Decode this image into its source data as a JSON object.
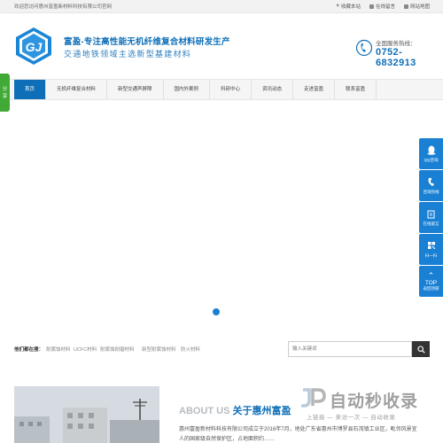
{
  "topbar": {
    "welcome": "欢迎您访问惠州富盈新材料科技有限公司官网",
    "links": [
      "收藏本站",
      "在线留言",
      "网站地图"
    ]
  },
  "header": {
    "brand_title": "富盈-专注高性能无机纤维复合材料研发生产",
    "brand_sub": "交通地铁领域主选新型基建材料",
    "hotline_label": "全国服务热线：",
    "hotline_number": "0752-6832913"
  },
  "nav": {
    "items": [
      "首页",
      "无机纤维复合材料",
      "新型交通声屏障",
      "国内外案例",
      "科研中心",
      "资讯动态",
      "走进富盈",
      "联系富盈"
    ]
  },
  "share": {
    "label_top": "分",
    "label_bottom": "享"
  },
  "float_bar": {
    "items": [
      "QQ咨询",
      "咨询热线",
      "在线留言",
      "扫一扫",
      "返回顶部"
    ],
    "top_label": "TOP"
  },
  "hot_search": {
    "label": "他们都在搜：",
    "keywords": [
      "耐腐蚀材料",
      "UCFC材料",
      "耐腐蚀耐磨材料",
      "新型耐腐蚀材料",
      "防火材料"
    ],
    "placeholder": "输入关键词"
  },
  "about": {
    "en": "ABOUT US",
    "cn": "关于惠州富盈",
    "text": "惠州富盈新材料科技有限公司成立于2016年7月，地处广东省惠州市博罗县石湾镇工业区，毗邻风景宜人的国家级自然保护区，占地面积约……"
  },
  "watermark": {
    "main": "自动秒收录",
    "sub": "上链接 — 来访一次 — 自动收录"
  },
  "colors": {
    "brand_blue": "#0e6fb8",
    "float_blue": "#1a80d4",
    "share_green": "#41a935"
  }
}
